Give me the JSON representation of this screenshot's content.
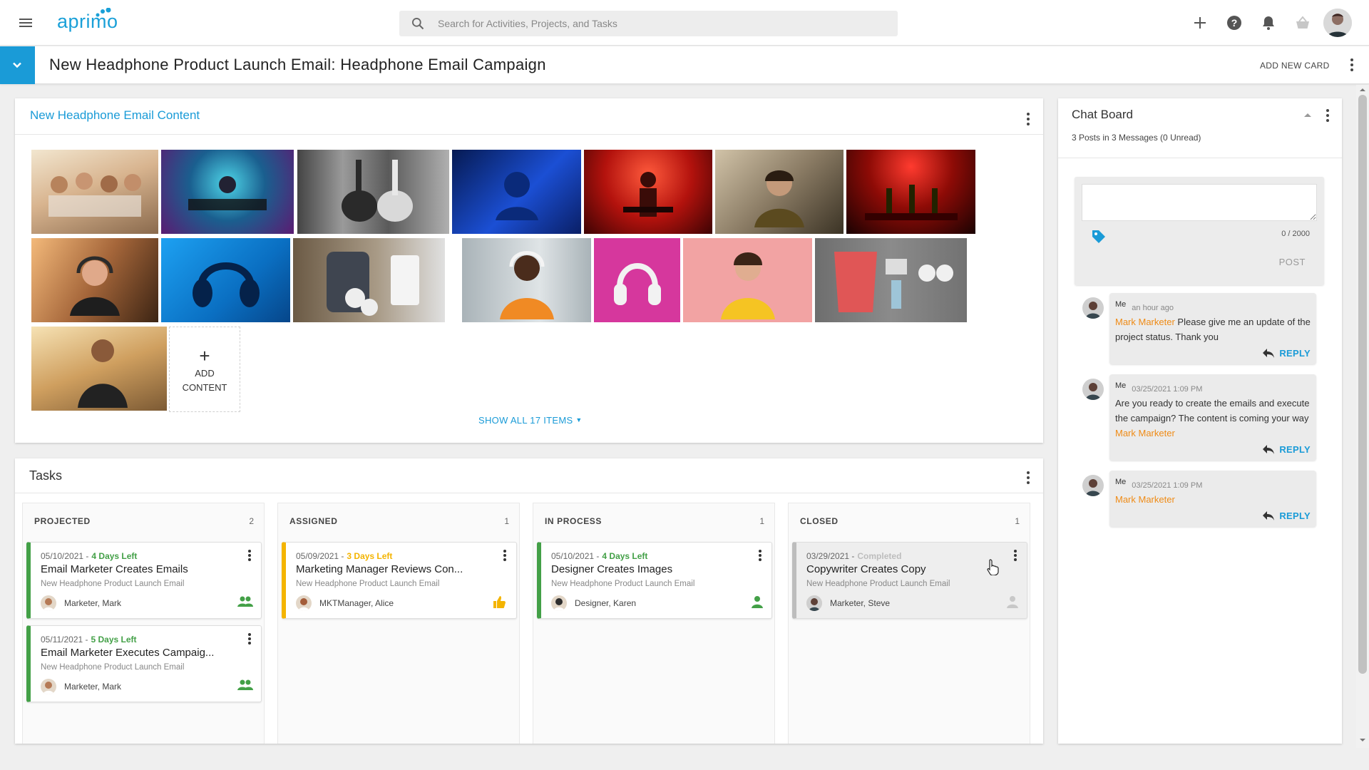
{
  "topbar": {
    "logo_text": "aprimo",
    "search_placeholder": "Search for Activities, Projects, and Tasks",
    "icons": [
      "menu-icon",
      "search-icon",
      "plus-icon",
      "help-icon",
      "bell-icon",
      "basket-icon"
    ]
  },
  "header": {
    "title": "New Headphone Product Launch Email: Headphone Email Campaign",
    "add_card": "ADD NEW CARD"
  },
  "content_card": {
    "title": "New Headphone Email Content",
    "add_content_line1": "ADD",
    "add_content_line2": "CONTENT",
    "show_all": "SHOW ALL 17 ITEMS"
  },
  "tasks": {
    "title": "Tasks",
    "columns": [
      {
        "name": "PROJECTED",
        "count": "2",
        "items": [
          {
            "date": "05/10/2021 -",
            "due": "4 Days Left",
            "due_color": "#43a047",
            "title": "Email Marketer Creates Emails",
            "project": "New Headphone Product Launch Email",
            "user": "Marketer, Mark",
            "status_icon": "group-icon"
          },
          {
            "date": "05/11/2021 -",
            "due": "5 Days Left",
            "due_color": "#43a047",
            "title": "Email Marketer Executes Campaig...",
            "project": "New Headphone Product Launch Email",
            "user": "Marketer, Mark",
            "status_icon": "group-icon"
          }
        ]
      },
      {
        "name": "ASSIGNED",
        "count": "1",
        "items": [
          {
            "date": "05/09/2021 -",
            "due": "3 Days Left",
            "due_color": "#f4b400",
            "title": "Marketing Manager Reviews Con...",
            "project": "New Headphone Product Launch Email",
            "user": "MKTManager, Alice",
            "status_icon": "thumbs-icon"
          }
        ]
      },
      {
        "name": "IN PROCESS",
        "count": "1",
        "items": [
          {
            "date": "05/10/2021 -",
            "due": "4 Days Left",
            "due_color": "#43a047",
            "title": "Designer Creates Images",
            "project": "New Headphone Product Launch Email",
            "user": "Designer, Karen",
            "status_icon": "person-icon"
          }
        ]
      },
      {
        "name": "CLOSED",
        "count": "1",
        "items": [
          {
            "date": "03/29/2021 -",
            "due": "Completed",
            "due_color": "#bdbdbd",
            "title": "Copywriter Creates Copy",
            "project": "New Headphone Product Launch Email",
            "user": "Marketer, Steve",
            "status_icon": "person-icon"
          }
        ]
      }
    ]
  },
  "chat": {
    "title": "Chat Board",
    "summary": "3 Posts in 3 Messages (0 Unread)",
    "char_count": "0 / 2000",
    "post": "POST",
    "reply": "REPLY",
    "messages": [
      {
        "author": "Me",
        "time": "an hour ago",
        "mention": "Mark Marketer",
        "text": "Please give me an update of the project status. Thank you",
        "mention_position": "start"
      },
      {
        "author": "Me",
        "time": "03/25/2021 1:09 PM",
        "mention": "Mark Marketer",
        "text": "Are you ready to create the emails and execute the campaign? The content is coming your way",
        "mention_position": "end"
      },
      {
        "author": "Me",
        "time": "03/25/2021 1:09 PM",
        "mention": "Mark Marketer",
        "text": "",
        "mention_position": "start"
      }
    ]
  },
  "colors": {
    "accent": "#1a9bd7",
    "mention": "#ef8b16",
    "on_track": "#43a047",
    "warning": "#f4b400",
    "completed": "#bdbdbd"
  }
}
